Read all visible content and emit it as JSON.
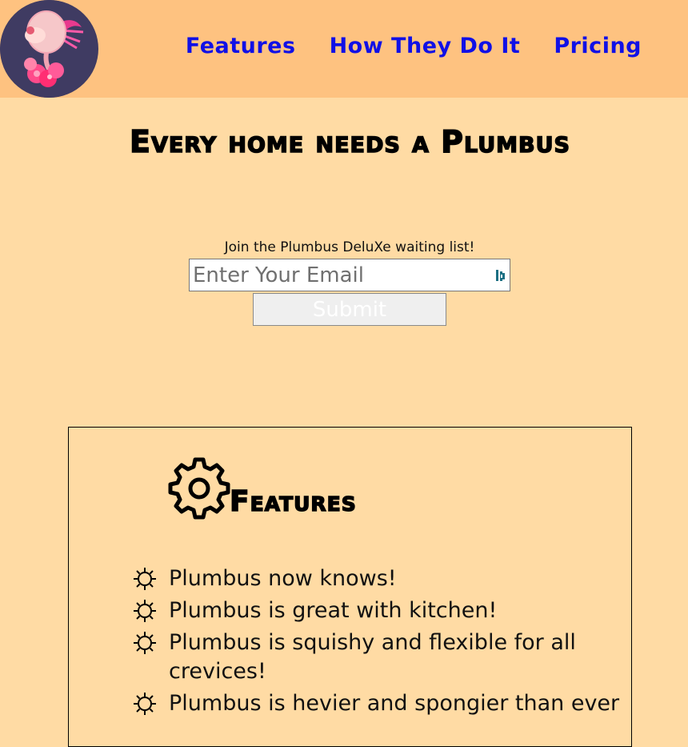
{
  "header": {
    "nav": [
      {
        "label": "Features"
      },
      {
        "label": "How They Do It"
      },
      {
        "label": "Pricing"
      }
    ]
  },
  "hero": {
    "title": "Every home needs a Plumbus"
  },
  "signup": {
    "label": "Join the Plumbus DeluXe waiting list!",
    "email_placeholder": "Enter Your Email",
    "email_value": "",
    "submit_label": "Submit"
  },
  "features": {
    "title": "Features",
    "items": [
      {
        "text": "Plumbus now knows!"
      },
      {
        "text": "Plumbus is great with kitchen!"
      },
      {
        "text": "Plumbus is squishy and flexible for all crevices!"
      },
      {
        "text": "Plumbus is hevier and spongier than ever"
      }
    ]
  },
  "colors": {
    "header_bg": "#fec280",
    "page_bg": "#ffdba4",
    "nav_link": "#1010e6",
    "logo_bg": "#3f3b62"
  },
  "icons": {
    "logo": "plumbus-logo-icon",
    "password_manager": "password-manager-icon",
    "features_heading": "gear-icon",
    "list_bullet": "sun-icon"
  }
}
